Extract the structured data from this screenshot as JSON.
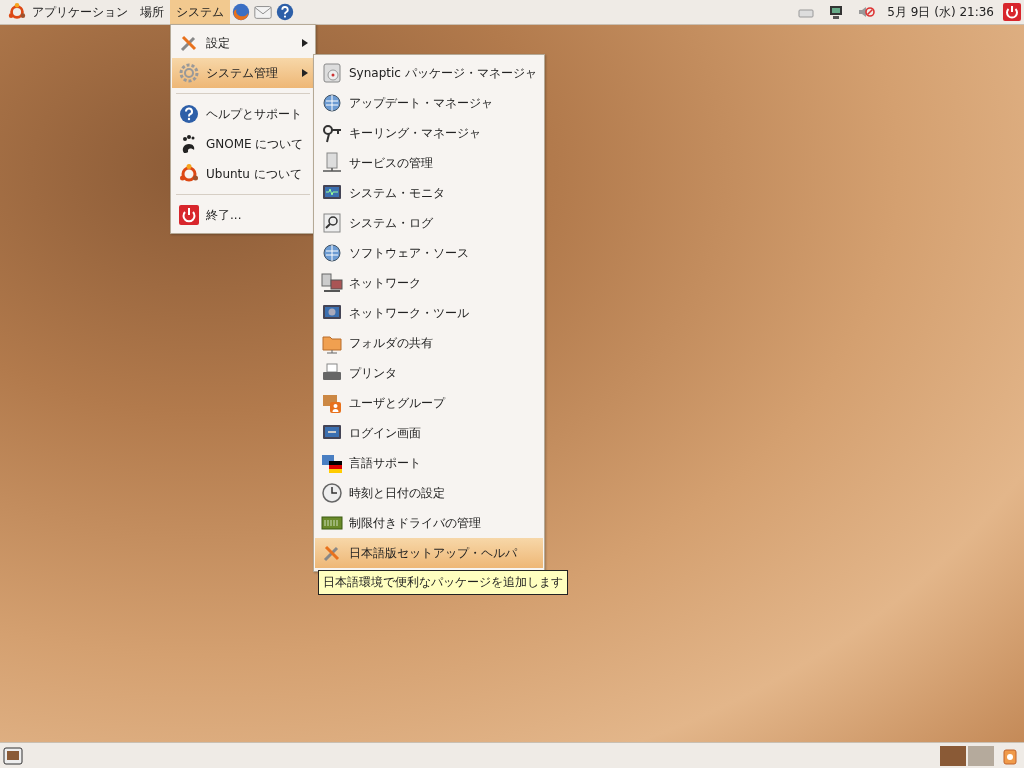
{
  "top_panel": {
    "menus": [
      {
        "label": "アプリケーション",
        "selected": false,
        "logo": true
      },
      {
        "label": "場所",
        "selected": false,
        "logo": false
      },
      {
        "label": "システム",
        "selected": true,
        "logo": false
      }
    ],
    "clock": "5月 9日 (水) 21:36"
  },
  "system_menu": {
    "items": [
      {
        "kind": "item",
        "label": "設定",
        "submenu": true,
        "selected": false
      },
      {
        "kind": "item",
        "label": "システム管理",
        "submenu": true,
        "selected": true
      },
      {
        "kind": "separator"
      },
      {
        "kind": "item",
        "label": "ヘルプとサポート",
        "submenu": false,
        "selected": false
      },
      {
        "kind": "item",
        "label": "GNOME について",
        "submenu": false,
        "selected": false
      },
      {
        "kind": "item",
        "label": "Ubuntu について",
        "submenu": false,
        "selected": false
      },
      {
        "kind": "separator"
      },
      {
        "kind": "item",
        "label": "終了...",
        "submenu": false,
        "selected": false
      }
    ]
  },
  "admin_menu": {
    "items": [
      {
        "label": "Synaptic パッケージ・マネージャ",
        "selected": false
      },
      {
        "label": "アップデート・マネージャ",
        "selected": false
      },
      {
        "label": "キーリング・マネージャ",
        "selected": false
      },
      {
        "label": "サービスの管理",
        "selected": false
      },
      {
        "label": "システム・モニタ",
        "selected": false
      },
      {
        "label": "システム・ログ",
        "selected": false
      },
      {
        "label": "ソフトウェア・ソース",
        "selected": false
      },
      {
        "label": "ネットワーク",
        "selected": false
      },
      {
        "label": "ネットワーク・ツール",
        "selected": false
      },
      {
        "label": "フォルダの共有",
        "selected": false
      },
      {
        "label": "プリンタ",
        "selected": false
      },
      {
        "label": "ユーザとグループ",
        "selected": false
      },
      {
        "label": "ログイン画面",
        "selected": false
      },
      {
        "label": "言語サポート",
        "selected": false
      },
      {
        "label": "時刻と日付の設定",
        "selected": false
      },
      {
        "label": "制限付きドライバの管理",
        "selected": false
      },
      {
        "label": "日本語版セットアップ・ヘルパ",
        "selected": true
      }
    ]
  },
  "tooltip": {
    "text": "日本語環境で便利なパッケージを追加します"
  },
  "bottom_panel": {
    "workspaces": [
      {
        "selected": true
      },
      {
        "selected": false
      }
    ]
  }
}
